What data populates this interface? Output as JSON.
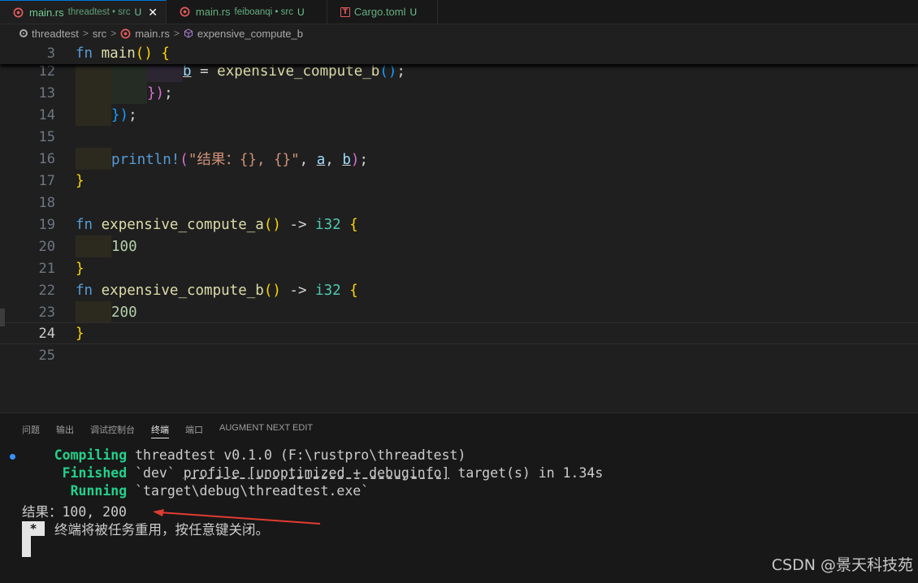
{
  "tabs": [
    {
      "name": "main.rs",
      "sub": "threadtest • src",
      "status": "U",
      "active": true,
      "close": "✕"
    },
    {
      "name": "main.rs",
      "sub": "feiboanqi • src",
      "status": "U",
      "active": false
    },
    {
      "name": "Cargo.toml",
      "sub": "",
      "status": "U",
      "active": false
    }
  ],
  "breadcrumb": {
    "items": [
      "threadtest",
      "src",
      "main.rs",
      "expensive_compute_b"
    ],
    "separator": ">"
  },
  "editor": {
    "sticky_line_number": "3",
    "line_numbers": [
      "12",
      "13",
      "14",
      "15",
      "16",
      "17",
      "18",
      "19",
      "20",
      "21",
      "22",
      "23",
      "24",
      "25"
    ],
    "current_line": "24"
  },
  "code": {
    "sticky": {
      "kw": "fn",
      "name": "main",
      "parens": "()",
      "brace": "{"
    },
    "l12": {
      "var": "b",
      "op": " = ",
      "call": "expensive_compute_b",
      "parens": "()",
      "semi": ";"
    },
    "l13": {
      "close": "})",
      "semi": ";"
    },
    "l14": {
      "close": "})",
      "semi": ";"
    },
    "l16": {
      "macro": "println!",
      "open": "(",
      "str": "\"结果：{}, {}\"",
      "sep1": ", ",
      "a": "a",
      "sep2": ", ",
      "b": "b",
      "close": ")",
      "semi": ";"
    },
    "l17": "}",
    "l19": {
      "kw": "fn",
      "name": "expensive_compute_a",
      "parens": "()",
      "arrow": " -> ",
      "type": "i32",
      "brace": "{"
    },
    "l20": "100",
    "l21": "}",
    "l22": {
      "kw": "fn",
      "name": "expensive_compute_b",
      "parens": "()",
      "arrow": " -> ",
      "type": "i32",
      "brace": "{"
    },
    "l23": "200",
    "l24": "}"
  },
  "panel": {
    "tabs": [
      "问题",
      "输出",
      "调试控制台",
      "终端",
      "端口",
      "AUGMENT NEXT EDIT"
    ],
    "active_tab": "终端"
  },
  "terminal": {
    "compiling_label": "Compiling",
    "compiling_text": " threadtest v0.1.0 (F:\\rustpro\\threadtest)",
    "finished_label": "Finished",
    "finished_pre": " `dev` ",
    "finished_profile": "profile [unoptimized + debuginfo]",
    "finished_post": " target(s) in 1.34s",
    "running_label": "Running",
    "running_text": " `target\\debug\\threadtest.exe`",
    "output": "结果：100, 200",
    "cursor_mark": "*",
    "reuse_message": "终端将被任务重用，按任意键关闭。"
  },
  "watermark": "CSDN @景天科技苑",
  "colors": {
    "accent": "#0078d4",
    "git_untracked": "#73c991",
    "annotation_arrow": "#e03c31"
  }
}
